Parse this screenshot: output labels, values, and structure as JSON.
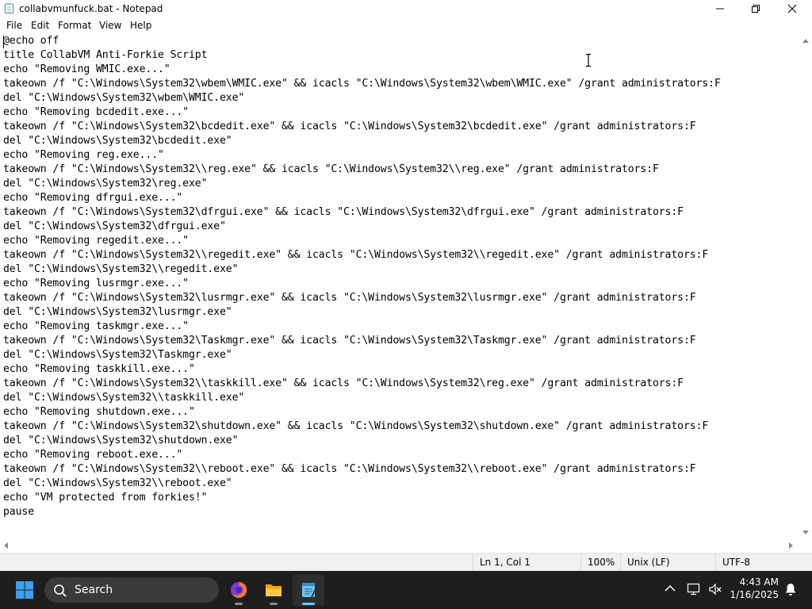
{
  "window": {
    "title": "collabvmunfuck.bat - Notepad",
    "icon": "notepad-icon"
  },
  "menu": [
    "File",
    "Edit",
    "Format",
    "View",
    "Help"
  ],
  "editor": {
    "lines": [
      "@echo off",
      "title CollabVM Anti-Forkie Script",
      "echo \"Removing WMIC.exe...\"",
      "takeown /f \"C:\\Windows\\System32\\wbem\\WMIC.exe\" && icacls \"C:\\Windows\\System32\\wbem\\WMIC.exe\" /grant administrators:F",
      "del \"C:\\Windows\\System32\\wbem\\WMIC.exe\"",
      "echo \"Removing bcdedit.exe...\"",
      "takeown /f \"C:\\Windows\\System32\\bcdedit.exe\" && icacls \"C:\\Windows\\System32\\bcdedit.exe\" /grant administrators:F",
      "del \"C:\\Windows\\System32\\bcdedit.exe\"",
      "echo \"Removing reg.exe...\"",
      "takeown /f \"C:\\Windows\\System32\\\\reg.exe\" && icacls \"C:\\Windows\\System32\\\\reg.exe\" /grant administrators:F",
      "del \"C:\\Windows\\System32\\reg.exe\"",
      "echo \"Removing dfrgui.exe...\"",
      "takeown /f \"C:\\Windows\\System32\\dfrgui.exe\" && icacls \"C:\\Windows\\System32\\dfrgui.exe\" /grant administrators:F",
      "del \"C:\\Windows\\System32\\dfrgui.exe\"",
      "echo \"Removing regedit.exe...\"",
      "takeown /f \"C:\\Windows\\System32\\\\regedit.exe\" && icacls \"C:\\Windows\\System32\\\\regedit.exe\" /grant administrators:F",
      "del \"C:\\Windows\\System32\\\\regedit.exe\"",
      "echo \"Removing lusrmgr.exe...\"",
      "takeown /f \"C:\\Windows\\System32\\lusrmgr.exe\" && icacls \"C:\\Windows\\System32\\lusrmgr.exe\" /grant administrators:F",
      "del \"C:\\Windows\\System32\\lusrmgr.exe\"",
      "echo \"Removing taskmgr.exe...\"",
      "takeown /f \"C:\\Windows\\System32\\Taskmgr.exe\" && icacls \"C:\\Windows\\System32\\Taskmgr.exe\" /grant administrators:F",
      "del \"C:\\Windows\\System32\\Taskmgr.exe\"",
      "echo \"Removing taskkill.exe...\"",
      "takeown /f \"C:\\Windows\\System32\\\\taskkill.exe\" && icacls \"C:\\Windows\\System32\\reg.exe\" /grant administrators:F",
      "del \"C:\\Windows\\System32\\\\taskkill.exe\"",
      "echo \"Removing shutdown.exe...\"",
      "takeown /f \"C:\\Windows\\System32\\shutdown.exe\" && icacls \"C:\\Windows\\System32\\shutdown.exe\" /grant administrators:F",
      "del \"C:\\Windows\\System32\\shutdown.exe\"",
      "echo \"Removing reboot.exe...\"",
      "takeown /f \"C:\\Windows\\System32\\\\reboot.exe\" && icacls \"C:\\Windows\\System32\\\\reboot.exe\" /grant administrators:F",
      "del \"C:\\Windows\\System32\\\\reboot.exe\"",
      "echo \"VM protected from forkies!\"",
      "pause"
    ]
  },
  "status": {
    "position": "Ln 1, Col 1",
    "zoom": "100%",
    "line_ending": "Unix (LF)",
    "encoding": "UTF-8"
  },
  "taskbar": {
    "search_label": "Search",
    "apps": [
      {
        "name": "firefox",
        "icon": "firefox-icon",
        "active": false
      },
      {
        "name": "file-explorer",
        "icon": "folder-icon",
        "active": false
      },
      {
        "name": "notepad",
        "icon": "notepad-icon",
        "active": true
      }
    ],
    "time": "4:43 AM",
    "date": "1/16/2025"
  },
  "colors": {
    "taskbar_bg": "#1e1e1e",
    "accent": "#60cdff",
    "windows_blue": "#0078d4"
  }
}
